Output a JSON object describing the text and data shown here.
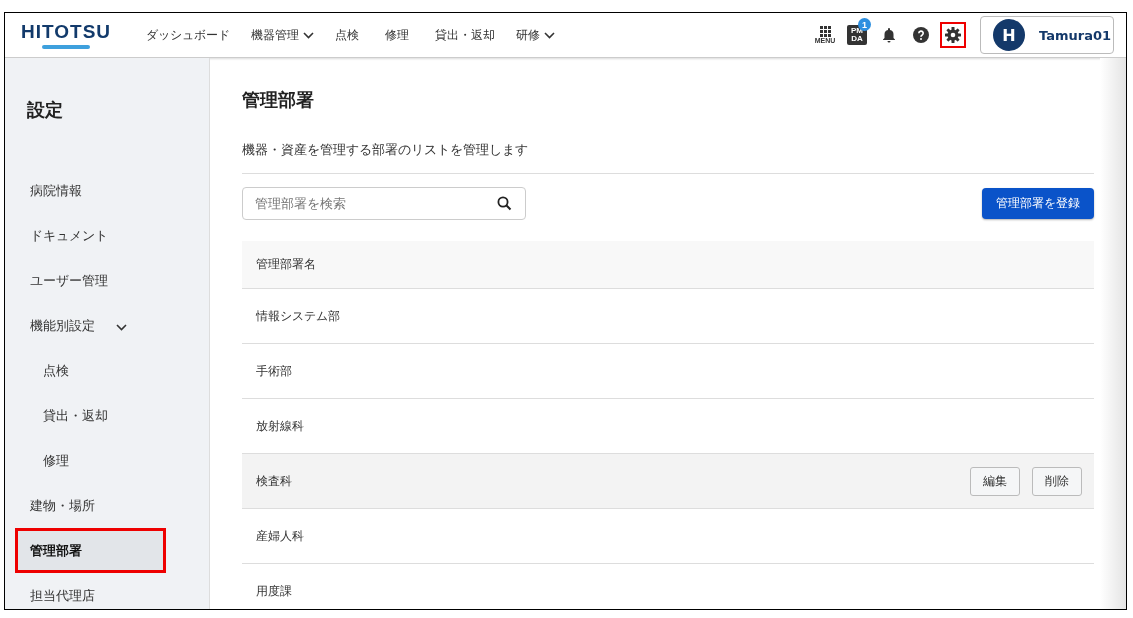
{
  "header": {
    "logo": "HITOTSU",
    "nav": [
      {
        "label": "ダッシュボード",
        "dropdown": false
      },
      {
        "label": "機器管理",
        "dropdown": true
      },
      {
        "label": "点検",
        "dropdown": false
      },
      {
        "label": "修理",
        "dropdown": false
      },
      {
        "label": "貸出・返却",
        "dropdown": false
      },
      {
        "label": "研修",
        "dropdown": true
      }
    ],
    "tools": [
      {
        "kind": "menu",
        "label": "MENU",
        "highlighted": false
      },
      {
        "kind": "pmda",
        "label_top": "PM",
        "label_bottom": "DA",
        "badge": "1",
        "highlighted": false
      },
      {
        "kind": "bell",
        "highlighted": false
      },
      {
        "kind": "help",
        "highlighted": false
      },
      {
        "kind": "settings",
        "highlighted": true
      }
    ],
    "user": {
      "initial": "H",
      "name": "Tamura01"
    }
  },
  "sidebar": {
    "title": "設定",
    "items": [
      {
        "label": "病院情報",
        "selected": false,
        "highlighted": false
      },
      {
        "label": "ドキュメント",
        "selected": false,
        "highlighted": false
      },
      {
        "label": "ユーザー管理",
        "selected": false,
        "highlighted": false
      },
      {
        "label": "機能別設定",
        "selected": false,
        "highlighted": false,
        "expanded": true,
        "children": [
          {
            "label": "点検",
            "selected": false,
            "highlighted": false
          },
          {
            "label": "貸出・返却",
            "selected": false,
            "highlighted": false
          },
          {
            "label": "修理",
            "selected": false,
            "highlighted": false
          }
        ]
      },
      {
        "label": "建物・場所",
        "selected": false,
        "highlighted": false
      },
      {
        "label": "管理部署",
        "selected": true,
        "highlighted": true
      },
      {
        "label": "担当代理店",
        "selected": false,
        "highlighted": false
      }
    ]
  },
  "main": {
    "title": "管理部署",
    "description": "機器・資産を管理する部署のリストを管理します",
    "search": {
      "placeholder": "管理部署を検索"
    },
    "register_button": "管理部署を登録",
    "table": {
      "columns": [
        "管理部署名"
      ],
      "rows": [
        {
          "name": "情報システム部",
          "hovered": false
        },
        {
          "name": "手術部",
          "hovered": false
        },
        {
          "name": "放射線科",
          "hovered": false
        },
        {
          "name": "検査科",
          "hovered": true,
          "actions": [
            "編集",
            "削除"
          ]
        },
        {
          "name": "産婦人科",
          "hovered": false
        },
        {
          "name": "用度課",
          "hovered": false
        }
      ]
    }
  }
}
